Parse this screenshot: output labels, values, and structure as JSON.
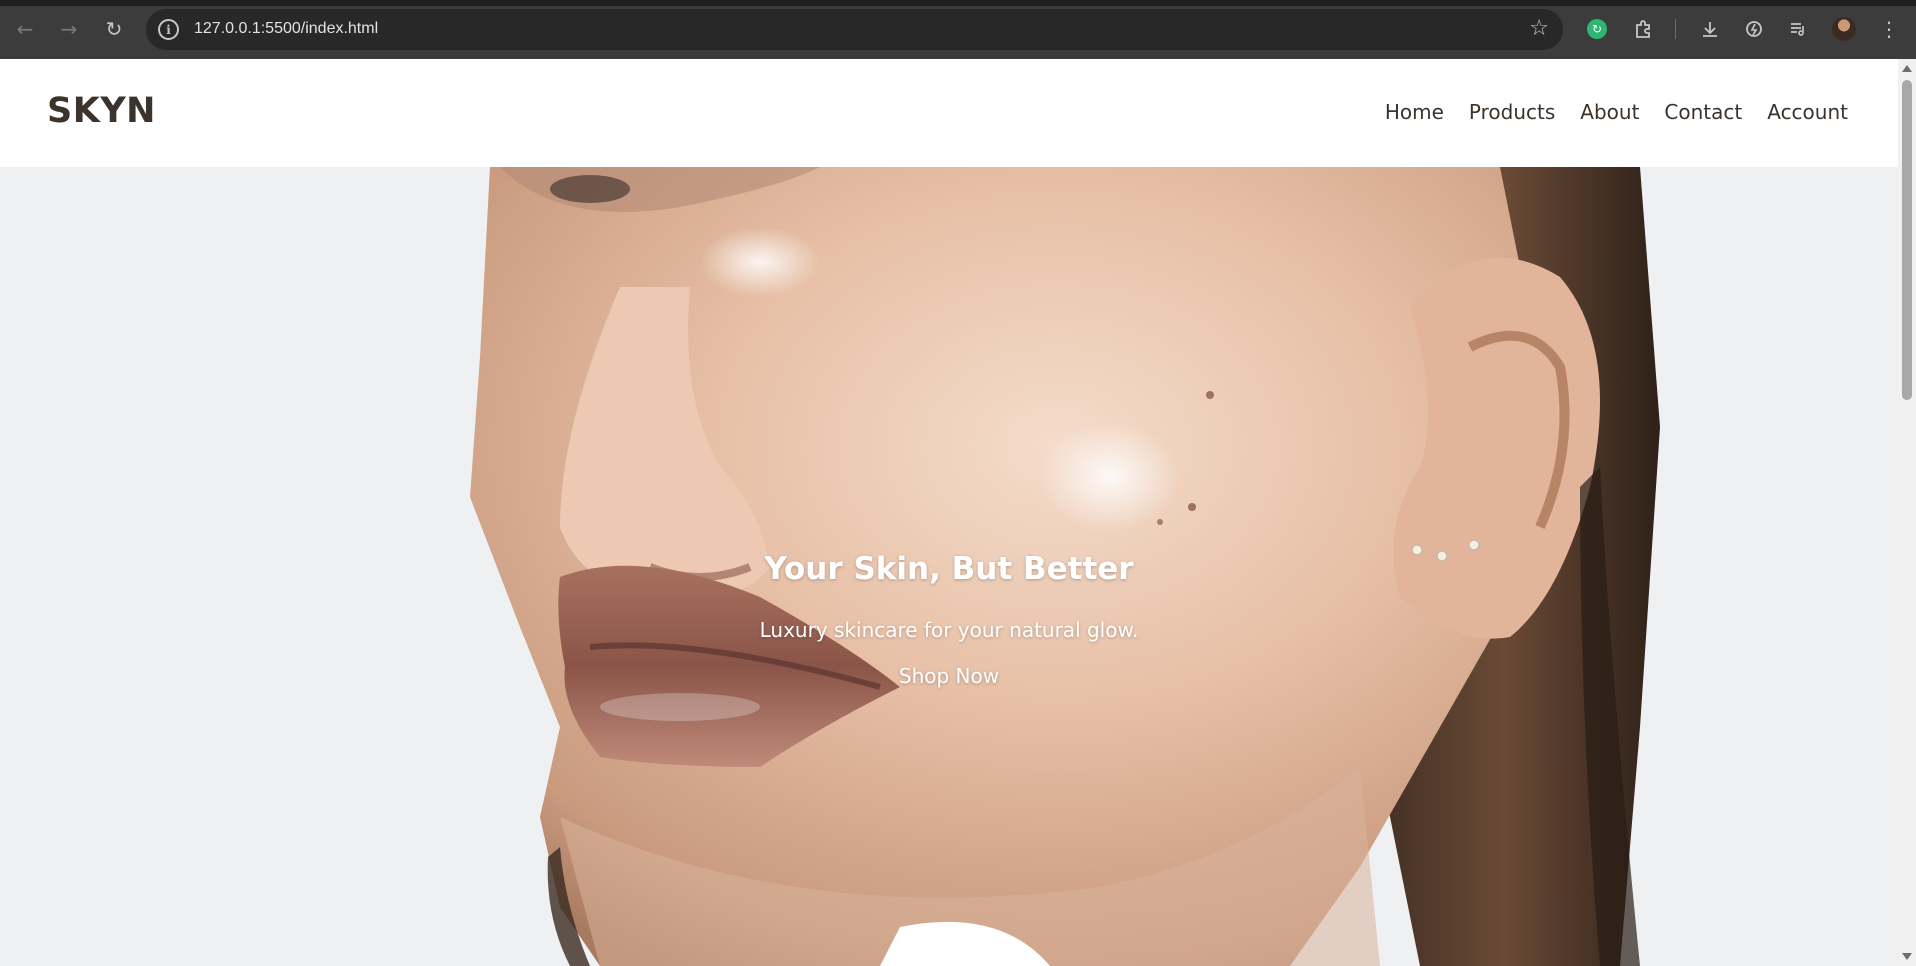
{
  "browser": {
    "url": "127.0.0.1:5500/index.html",
    "icons": {
      "back": "arrow-left-icon",
      "forward": "arrow-right-icon",
      "reload": "reload-icon",
      "site_info": "info-icon",
      "bookmark": "star-icon",
      "extension_sync": "sync-extension-icon",
      "extensions": "puzzle-icon",
      "downloads": "download-icon",
      "performance": "performance-icon",
      "reading_list": "reading-list-icon",
      "menu": "kebab-menu-icon"
    }
  },
  "site": {
    "logo": "SKYN",
    "nav": [
      "Home",
      "Products",
      "About",
      "Contact",
      "Account"
    ]
  },
  "hero": {
    "title": "Your Skin, But Better",
    "subtitle": "Luxury skincare for your natural glow.",
    "cta": "Shop Now"
  },
  "colors": {
    "text_dark": "#3b332c",
    "hero_background": "#eef0f1",
    "chrome_background": "#3c3c3c",
    "omnibox": "#282828"
  }
}
